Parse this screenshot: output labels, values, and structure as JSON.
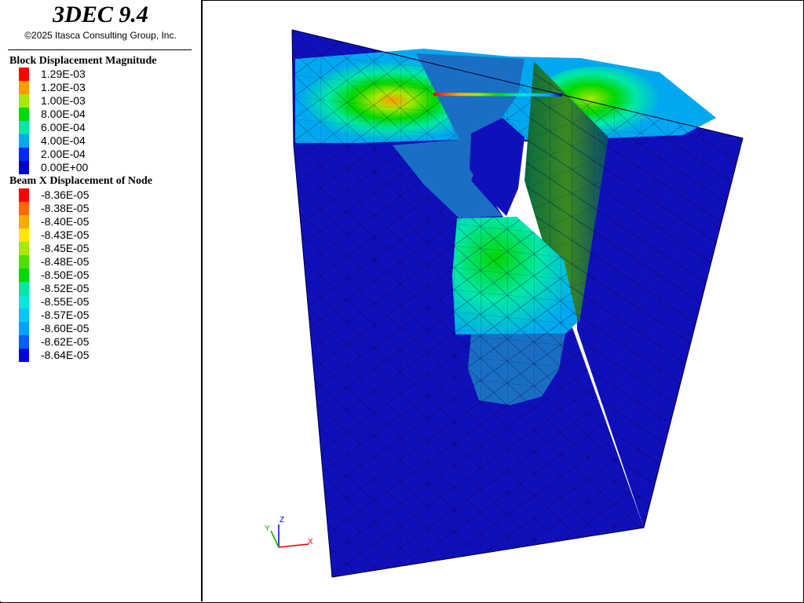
{
  "app": {
    "title": "3DEC 9.4",
    "copyright": "©2025 Itasca Consulting Group, Inc."
  },
  "legend": {
    "block": {
      "title": "Block  Displacement Magnitude",
      "entries": [
        {
          "label": "1.29E-03",
          "color": "#ff0000"
        },
        {
          "label": "1.20E-03",
          "color": "#ff9a00"
        },
        {
          "label": "1.00E-03",
          "color": "#a8e800"
        },
        {
          "label": "8.00E-04",
          "color": "#00d800"
        },
        {
          "label": "6.00E-04",
          "color": "#00e8a8"
        },
        {
          "label": "4.00E-04",
          "color": "#00a8f0"
        },
        {
          "label": "2.00E-04",
          "color": "#0028ff"
        },
        {
          "label": "0.00E+00",
          "color": "#0000cc"
        }
      ]
    },
    "beam": {
      "title": "Beam X Displacement of Node",
      "entries": [
        {
          "label": "-8.36E-05",
          "color": "#ff0000"
        },
        {
          "label": "-8.38E-05",
          "color": "#ff6a00"
        },
        {
          "label": "-8.40E-05",
          "color": "#ffa800"
        },
        {
          "label": "-8.43E-05",
          "color": "#ffe800"
        },
        {
          "label": "-8.45E-05",
          "color": "#a8e800"
        },
        {
          "label": "-8.48E-05",
          "color": "#50e000"
        },
        {
          "label": "-8.50E-05",
          "color": "#00d800"
        },
        {
          "label": "-8.52E-05",
          "color": "#00e8a0"
        },
        {
          "label": "-8.55E-05",
          "color": "#00e8e0"
        },
        {
          "label": "-8.57E-05",
          "color": "#00c8f8"
        },
        {
          "label": "-8.60E-05",
          "color": "#00a0ff"
        },
        {
          "label": "-8.62E-05",
          "color": "#0060ff"
        },
        {
          "label": "-8.64E-05",
          "color": "#0000e0"
        }
      ]
    }
  },
  "axes": {
    "x": "X",
    "y": "Y",
    "z": "Z"
  },
  "colors": {
    "model_dark": "#1010bb",
    "model_mid": "#1a6fc4",
    "mesh_line": "#000044"
  }
}
